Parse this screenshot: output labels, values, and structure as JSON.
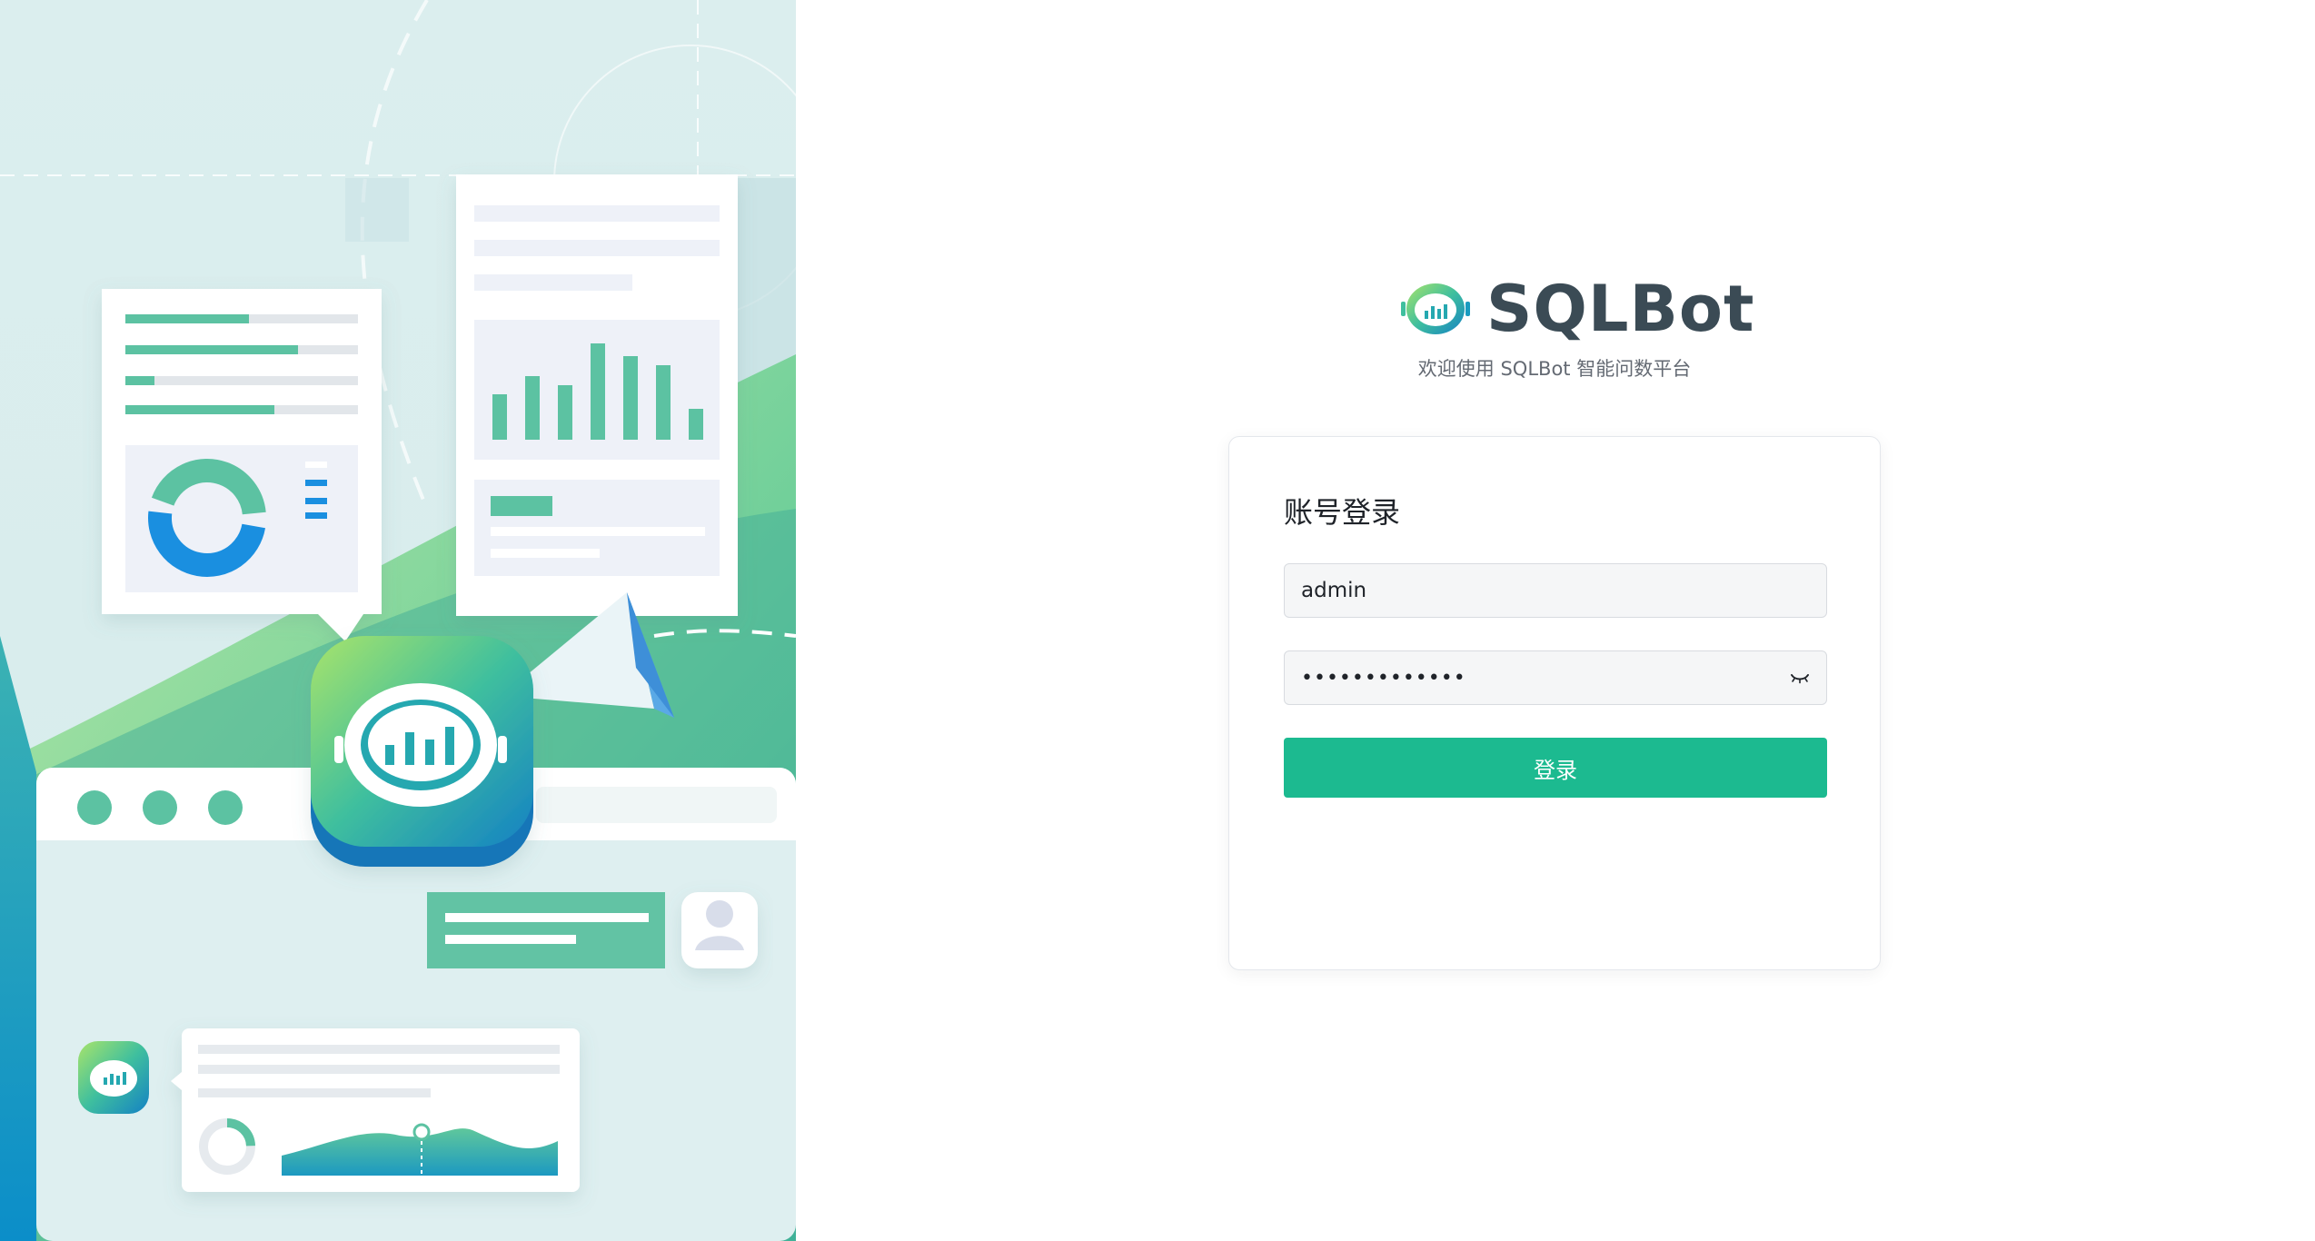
{
  "brand": {
    "name": "SQLBot",
    "subtitle": "欢迎使用 SQLBot 智能问数平台"
  },
  "login": {
    "title": "账号登录",
    "username_value": "admin",
    "password_value": "•••••••••••••",
    "button_label": "登录"
  },
  "colors": {
    "primary": "#1cba90",
    "brand_text": "#3b4b55",
    "card_border": "#e4e7ec",
    "input_bg": "#f5f6f7"
  },
  "icons": {
    "logo": "robot-chart-icon",
    "password_toggle": "eye-closed-icon",
    "avatar": "user-avatar-icon"
  }
}
